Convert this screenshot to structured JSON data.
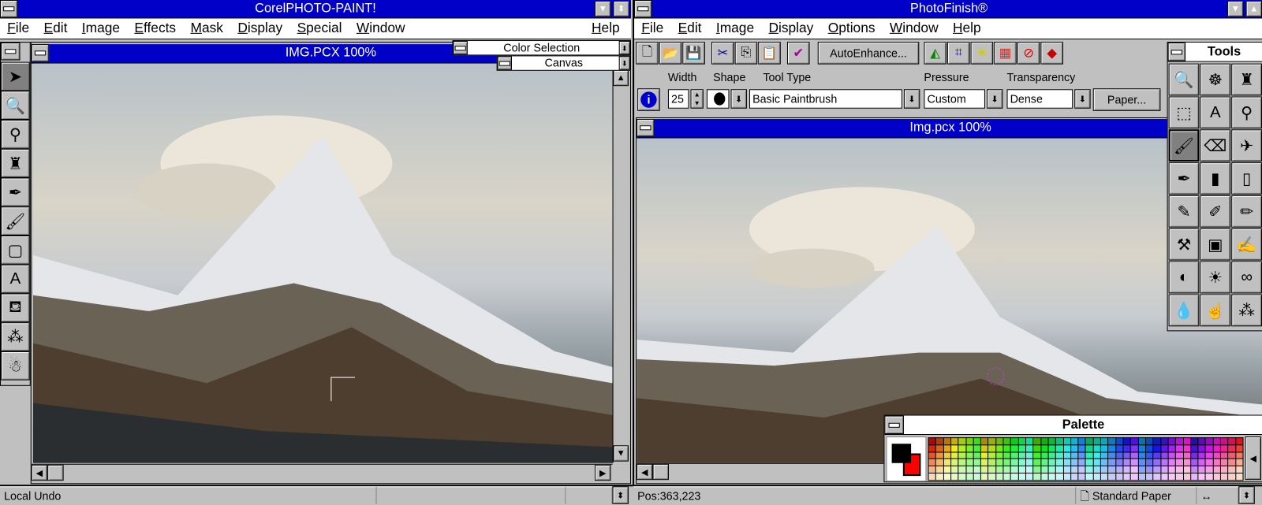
{
  "left_app": {
    "title": "CorelPHOTO-PAINT!",
    "menu": [
      "File",
      "Edit",
      "Image",
      "Effects",
      "Mask",
      "Display",
      "Special",
      "Window"
    ],
    "help": "Help",
    "document_title": "IMG.PCX  100%",
    "rollups": {
      "color_selection": "Color Selection",
      "canvas": "Canvas"
    },
    "tools": [
      "pointer-icon",
      "zoom-icon",
      "eyedropper-icon",
      "spraycan-icon",
      "pen-icon",
      "paintbrush-icon",
      "rectangle-icon",
      "text-icon",
      "paint-bucket-icon",
      "clone-icon",
      "pattern-icon"
    ],
    "status": {
      "left": "Local Undo",
      "middle": "",
      "right": ""
    }
  },
  "right_app": {
    "title": "PhotoFinish®",
    "menu": [
      "File",
      "Edit",
      "Image",
      "Display",
      "Options",
      "Window",
      "Help"
    ],
    "toolbar": {
      "autoenhance": "AutoEnhance...",
      "paper": "Paper..."
    },
    "labels": {
      "width": "Width",
      "shape": "Shape",
      "tool_type": "Tool Type",
      "pressure": "Pressure",
      "transparency": "Transparency"
    },
    "values": {
      "width": "25",
      "tool_type": "Basic Paintbrush",
      "pressure": "Custom",
      "transparency": "Dense"
    },
    "document_title": "Img.pcx  100%",
    "tools_title": "Tools",
    "tools": [
      "zoom-icon",
      "compass-icon",
      "spraycan-icon",
      "marquee-icon",
      "text-icon",
      "eyedropper-icon",
      "paintbrush-icon",
      "eraser-icon",
      "airbrush-icon",
      "pen-icon",
      "marker-icon",
      "chalk-icon",
      "pencil-icon",
      "highlighter-icon",
      "crayon-icon",
      "stamp-icon",
      "fill-icon",
      "calligraphy-icon",
      "contrast-icon",
      "brightness-icon",
      "glasses-icon",
      "water-drop-icon",
      "smudge-icon",
      "clone-icon"
    ],
    "active_tool": "paintbrush-icon",
    "palette_title": "Palette",
    "colors": {
      "foreground": "#000000",
      "background": "#ff0000",
      "titlebar": "#0000c8"
    },
    "status": {
      "position": "Pos:363,223",
      "paper": "Standard Paper"
    }
  }
}
